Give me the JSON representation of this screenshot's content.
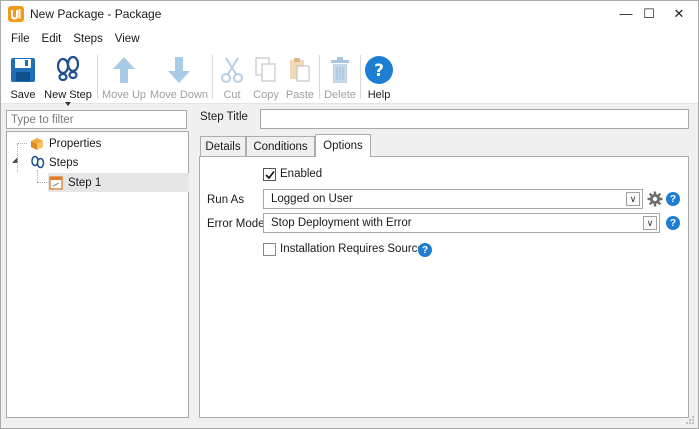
{
  "window": {
    "title": "New Package - Package",
    "controls": {
      "minimize": "—",
      "maximize": "☐",
      "close": "✕"
    }
  },
  "menu": [
    "File",
    "Edit",
    "Steps",
    "View"
  ],
  "toolbar": {
    "save": "Save",
    "new_step": "New Step",
    "move_up": "Move Up",
    "move_down": "Move Down",
    "cut": "Cut",
    "copy": "Copy",
    "paste": "Paste",
    "delete": "Delete",
    "help": "Help"
  },
  "sidebar": {
    "filter_placeholder": "Type to filter",
    "filter_value": "",
    "tree": [
      {
        "label": "Properties",
        "icon": "properties-icon"
      },
      {
        "label": "Steps",
        "icon": "steps-icon",
        "expanded": true
      },
      {
        "label": "Step 1",
        "icon": "step-icon",
        "selected": true
      }
    ]
  },
  "main": {
    "step_title_label": "Step Title",
    "step_title_value": "",
    "tabs": [
      "Details",
      "Conditions",
      "Options"
    ],
    "active_tab": "Options",
    "options": {
      "enabled_label": "Enabled",
      "enabled_checked": true,
      "run_as_label": "Run As",
      "run_as_value": "Logged on User",
      "error_mode_label": "Error Mode",
      "error_mode_value": "Stop Deployment with Error",
      "install_source_label": "Installation Requires Source",
      "install_source_checked": false
    }
  },
  "colors": {
    "accent": "#1e7fd2",
    "brand_orange": "#f39a1e",
    "disabled": "#a0a0a0"
  }
}
